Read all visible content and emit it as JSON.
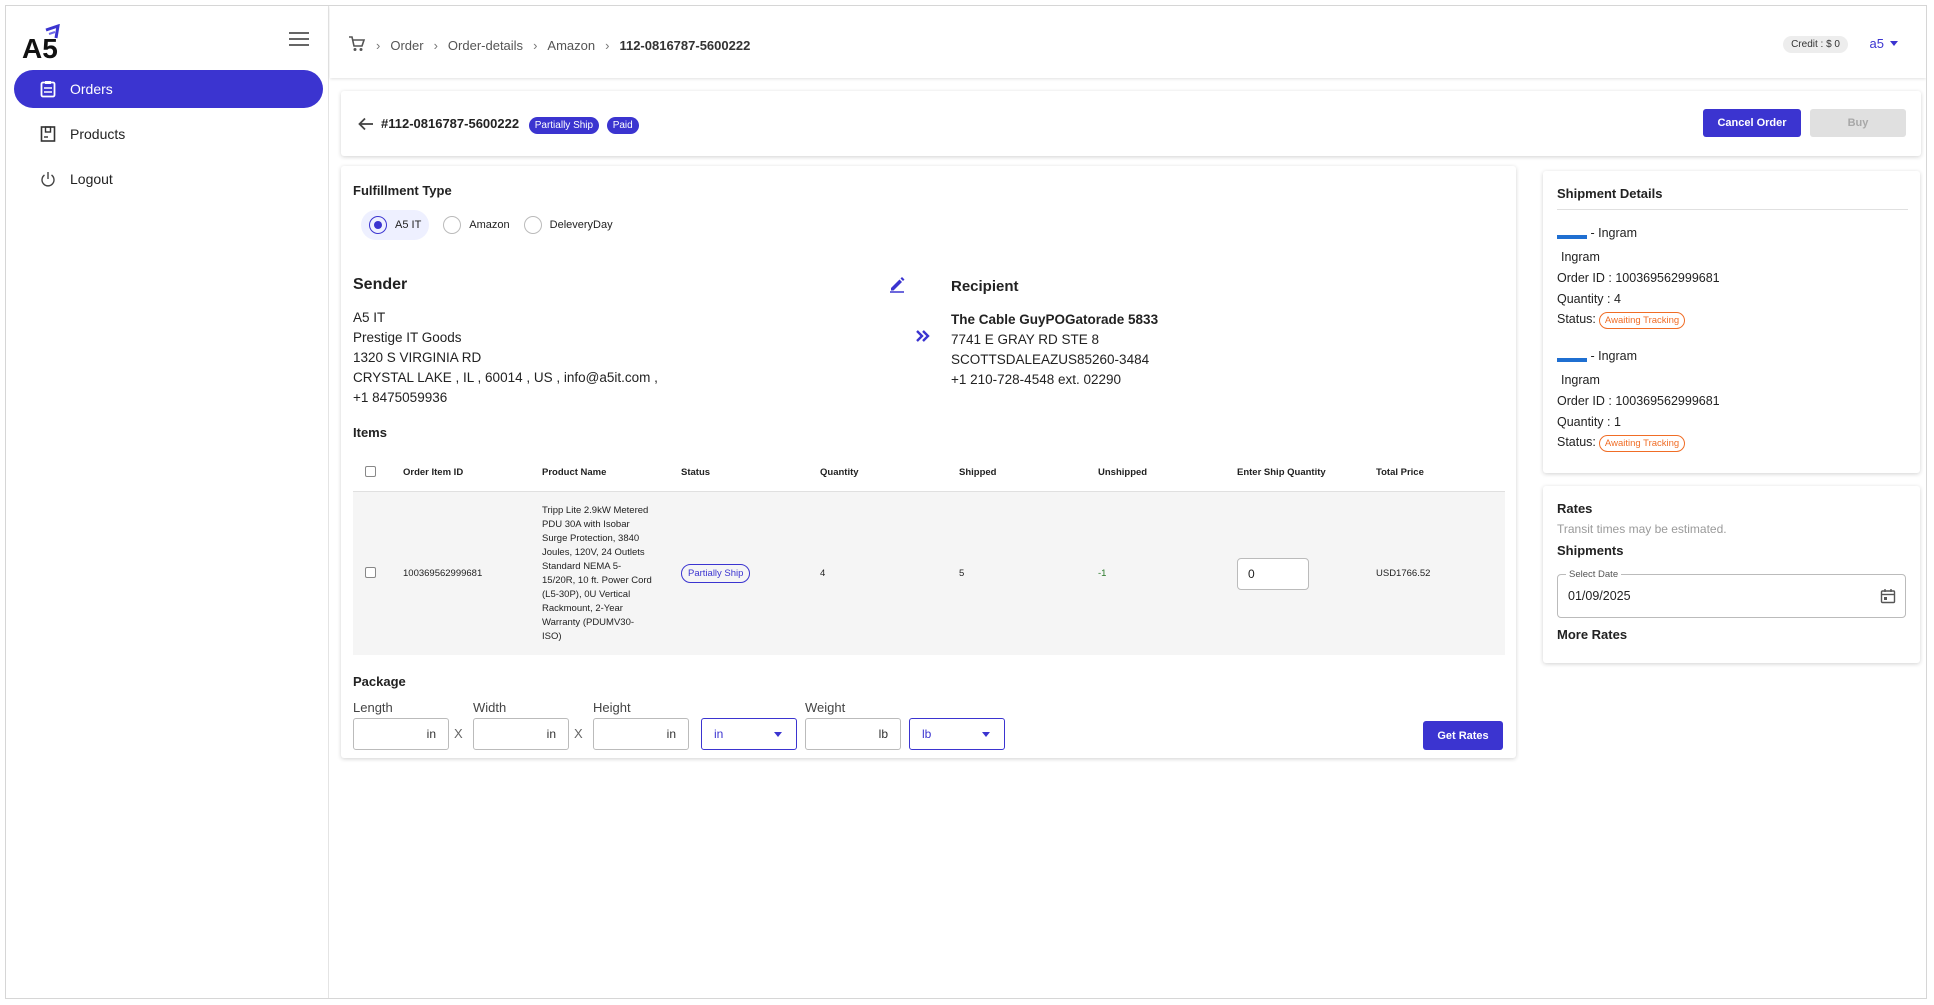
{
  "app": {
    "brand": "A5"
  },
  "sidebar": {
    "items": [
      {
        "label": "Orders",
        "icon": "clipboard-icon",
        "active": true
      },
      {
        "label": "Products",
        "icon": "box-icon",
        "active": false
      },
      {
        "label": "Logout",
        "icon": "power-icon",
        "active": false
      }
    ]
  },
  "topbar": {
    "breadcrumb": [
      "Order",
      "Order-details",
      "Amazon",
      "112-0816787-5600222"
    ],
    "credit": "Credit : $ 0",
    "user": "a5"
  },
  "header": {
    "order_no": "#112-0816787-5600222",
    "badges": [
      "Partially Ship",
      "Paid"
    ],
    "cancel_label": "Cancel Order",
    "buy_label": "Buy"
  },
  "fulfillment": {
    "title": "Fulfillment Type",
    "options": [
      "A5 IT",
      "Amazon",
      "DeleveryDay"
    ],
    "selected": "A5 IT"
  },
  "sender": {
    "title": "Sender",
    "lines": [
      "A5 IT",
      "Prestige IT Goods",
      "1320 S VIRGINIA RD",
      "CRYSTAL LAKE , IL , 60014 , US , info@a5it.com ,",
      "+1 8475059936"
    ]
  },
  "recipient": {
    "title": "Recipient",
    "lines": [
      "The Cable GuyPOGatorade 5833",
      "7741 E GRAY RD STE 8",
      "SCOTTSDALEAZUS85260-3484",
      "+1 210-728-4548 ext. 02290"
    ]
  },
  "items": {
    "title": "Items",
    "headers": [
      "Order Item ID",
      "Product Name",
      "Status",
      "Quantity",
      "Shipped",
      "Unshipped",
      "Enter Ship Quantity",
      "Total Price"
    ],
    "rows": [
      {
        "order_item_id": "100369562999681",
        "product_name": "Tripp Lite 2.9kW Metered PDU 30A with Isobar Surge Protection, 3840 Joules, 120V, 24 Outlets Standard NEMA 5-15/20R, 10 ft. Power Cord (L5-30P), 0U Vertical Rackmount, 2-Year Warranty (PDUMV30-ISO)",
        "status": "Partially Ship",
        "quantity": "4",
        "shipped": "5",
        "unshipped": "-1",
        "ship_qty": "0",
        "total_price": "USD1766.52"
      }
    ]
  },
  "package": {
    "title": "Package",
    "length_label": "Length",
    "width_label": "Width",
    "height_label": "Height",
    "weight_label": "Weight",
    "dim_unit": "in",
    "weight_unit": "lb",
    "x": "X",
    "get_rates_label": "Get Rates"
  },
  "shipment_details": {
    "title": "Shipment Details",
    "entries": [
      {
        "carrier": "- Ingram",
        "name": "Ingram",
        "order_id": "Order ID : 100369562999681",
        "quantity": "Quantity : 4",
        "status_label": "Status:",
        "status": "Awaiting Tracking"
      },
      {
        "carrier": "- Ingram",
        "name": "Ingram",
        "order_id": "Order ID : 100369562999681",
        "quantity": "Quantity : 1",
        "status_label": "Status:",
        "status": "Awaiting Tracking"
      }
    ]
  },
  "rates": {
    "title": "Rates",
    "note": "Transit times may be estimated.",
    "shipments_label": "Shipments",
    "date_label": "Select Date",
    "date_value": "01/09/2025",
    "more_rates": "More Rates"
  },
  "colors": {
    "accent": "#3b34d0",
    "warning": "#f06d26"
  }
}
